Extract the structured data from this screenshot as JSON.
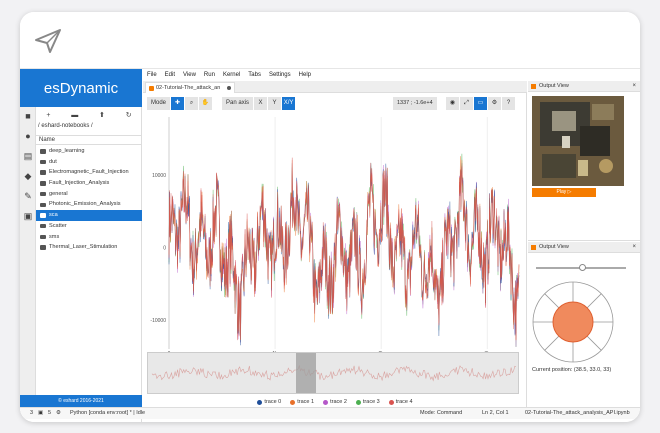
{
  "app": {
    "brand": "esDynamic",
    "copyright": "© eshard 2016-2021"
  },
  "menubar": [
    "File",
    "Edit",
    "View",
    "Run",
    "Kernel",
    "Tabs",
    "Settings",
    "Help"
  ],
  "filebrowser": {
    "toolbar_icons": [
      "plus-icon",
      "new-folder-icon",
      "upload-icon",
      "refresh-icon"
    ],
    "breadcrumb": "/ eshard-notebooks /",
    "column_header": "Name",
    "items": [
      {
        "label": "deep_learning",
        "selected": false
      },
      {
        "label": "dut",
        "selected": false
      },
      {
        "label": "Electromagnetic_Fault_Injection",
        "selected": false
      },
      {
        "label": "Fault_Injection_Analysis",
        "selected": false
      },
      {
        "label": "general",
        "selected": false
      },
      {
        "label": "Photonic_Emission_Analysis",
        "selected": false
      },
      {
        "label": "sca",
        "selected": true
      },
      {
        "label": "Scatter",
        "selected": false
      },
      {
        "label": "sms",
        "selected": false
      },
      {
        "label": "Thermal_Laser_Stimulation",
        "selected": false
      }
    ]
  },
  "notebook": {
    "tab_label": "02-Tutorial-The_attack_an",
    "toolbar": {
      "mode_label": "Mode",
      "pan_axis_label": "Pan axis",
      "axis_x": "X",
      "axis_y": "Y",
      "axis_xy": "X/Y",
      "coord_readout": "1337 ; -1.6e+4"
    },
    "legend": [
      "trace 0",
      "trace 1",
      "trace 2",
      "trace 3",
      "trace 4"
    ],
    "colors": [
      "#1f4e99",
      "#e8702a",
      "#b558c9",
      "#4caf50",
      "#d9534f"
    ]
  },
  "chart_data": {
    "type": "line",
    "title": "",
    "xlabel": "",
    "ylabel": "",
    "yticks": [
      "10000",
      "0",
      "-10000"
    ],
    "xticks": [
      "0",
      "1k",
      "2k",
      "3k"
    ],
    "ylim": [
      -14000,
      18000
    ],
    "xlim": [
      0,
      3300
    ],
    "series": [
      {
        "name": "trace 0",
        "x": [
          0,
          3300
        ],
        "y": [
          0,
          0
        ]
      },
      {
        "name": "trace 1",
        "x": [
          0,
          3300
        ],
        "y": [
          0,
          0
        ]
      },
      {
        "name": "trace 2",
        "x": [
          0,
          3300
        ],
        "y": [
          0,
          0
        ]
      },
      {
        "name": "trace 3",
        "x": [
          0,
          3300
        ],
        "y": [
          0,
          0
        ]
      },
      {
        "name": "trace 4",
        "x": [
          0,
          3300
        ],
        "y": [
          0,
          0
        ]
      }
    ]
  },
  "output_view_1": {
    "title": "Output View",
    "play_label": "Play ▷"
  },
  "output_view_2": {
    "title": "Output View",
    "current_position": "Current position: (38.5, 33.0, 33)"
  },
  "statusbar": {
    "left_counts": [
      "3",
      "5"
    ],
    "kernel": "Python [conda env:root] * | Idle",
    "mode": "Mode: Command",
    "cursor": "Ln 2, Col 1",
    "file": "02-Tutorial-The_attack_analysis_API.ipynb"
  }
}
